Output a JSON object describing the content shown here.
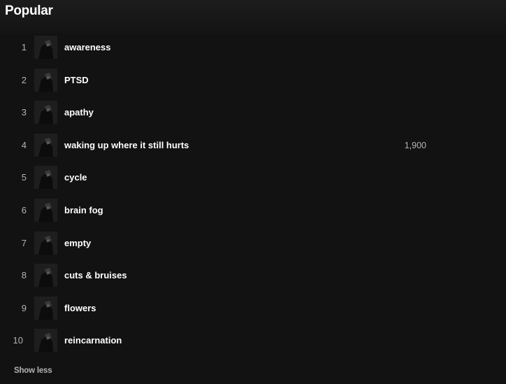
{
  "section": {
    "title": "Popular",
    "toggle_label": "Show less"
  },
  "tracks": [
    {
      "rank": "1",
      "title": "awareness",
      "plays": ""
    },
    {
      "rank": "2",
      "title": "PTSD",
      "plays": ""
    },
    {
      "rank": "3",
      "title": "apathy",
      "plays": ""
    },
    {
      "rank": "4",
      "title": "waking up where it still hurts",
      "plays": "1,900"
    },
    {
      "rank": "5",
      "title": "cycle",
      "plays": ""
    },
    {
      "rank": "6",
      "title": "brain fog",
      "plays": ""
    },
    {
      "rank": "7",
      "title": "empty",
      "plays": ""
    },
    {
      "rank": "8",
      "title": "cuts & bruises",
      "plays": ""
    },
    {
      "rank": "9",
      "title": "flowers",
      "plays": ""
    },
    {
      "rank": "10",
      "title": "reincarnation",
      "plays": ""
    }
  ],
  "colors": {
    "background": "#121212",
    "text_primary": "#ffffff",
    "text_secondary": "#b3b3b3"
  }
}
